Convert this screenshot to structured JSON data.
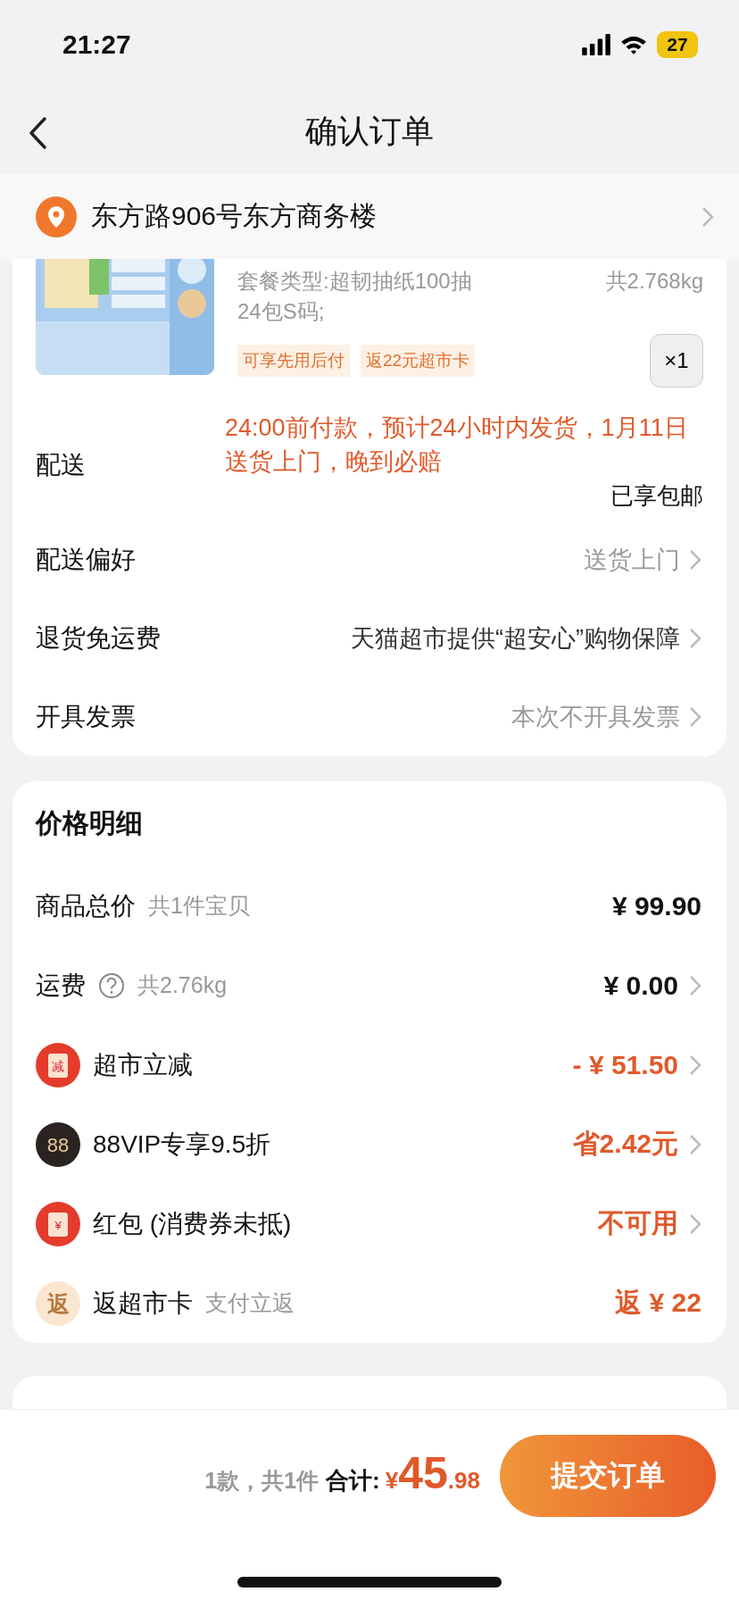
{
  "status_bar": {
    "time": "21:27",
    "battery": "27"
  },
  "nav": {
    "title": "确认订单"
  },
  "address": {
    "text": "东方路906号东方商务楼"
  },
  "product": {
    "spec": "套餐类型:超韧抽纸100抽24包S码;",
    "weight": "共2.768kg",
    "tags": [
      "可享先用后付",
      "返22元超市卡"
    ],
    "quantity": "×1"
  },
  "order_rows": [
    {
      "kind": "delivery",
      "label": "配送",
      "note": "24:00前付款，预计24小时内发货，1月11日送货上门，晚到必赔",
      "value": "已享包邮"
    },
    {
      "kind": "link",
      "label": "配送偏好",
      "value": "送货上门"
    },
    {
      "kind": "link",
      "label": "退货免运费",
      "value": "天猫超市提供“超安心”购物保障",
      "dark": true
    },
    {
      "kind": "link",
      "label": "开具发票",
      "value": "本次不开具发票",
      "dark": false
    }
  ],
  "price_detail": {
    "title": "价格明细",
    "rows": [
      {
        "label": "商品总价",
        "sub": "共1件宝贝",
        "value": "¥ 99.90",
        "highlight": false,
        "arrow": false
      },
      {
        "label": "运费",
        "help": true,
        "sub": "共2.76kg",
        "value": "¥ 0.00",
        "highlight": false,
        "arrow": true
      },
      {
        "kind": "reduce",
        "icon_text": "减",
        "label": "超市立减",
        "value": "- ¥ 51.50",
        "highlight": true,
        "arrow": true
      },
      {
        "kind": "vip",
        "icon_text": "88",
        "label": "88VIP专享9.5折",
        "value": "省2.42元",
        "highlight": true,
        "arrow": true
      },
      {
        "kind": "redpacket",
        "icon_text": "¥",
        "label": "红包 (消费券未抵)",
        "value": "不可用",
        "highlight": true,
        "arrow": true
      },
      {
        "kind": "rebate",
        "icon_text": "返",
        "label": "返超市卡",
        "sub": "支付立返",
        "value": "返 ¥ 22",
        "highlight": true,
        "arrow": false
      }
    ]
  },
  "footer": {
    "count": "1款，共1件",
    "total_label": "合计:",
    "currency": "¥",
    "integer": "45",
    "decimal": ".98",
    "submit": "提交订单"
  }
}
